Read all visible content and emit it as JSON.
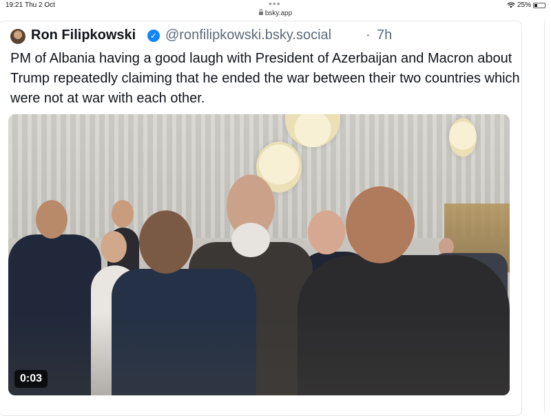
{
  "status_bar": {
    "time": "19:21",
    "date": "Thu 2 Oct",
    "dots": "•••",
    "battery": "25%"
  },
  "browser": {
    "url": "bsky.app"
  },
  "post": {
    "author_name": "Ron Filipkowski",
    "verified_glyph": "✓",
    "handle": "@ronfilipkowski.bsky.social",
    "separator": "·",
    "time": "7h",
    "text": "PM of Albania having a good laugh with President of Azerbaijan and Macron about Trump repeatedly claiming that he ended the war between their two countries which were not at war with each other.",
    "media": {
      "video_time": "0:03"
    }
  },
  "icons": {
    "wifi": "wifi-icon",
    "battery": "battery-icon",
    "lock": "lock-icon",
    "verified": "verified-badge-icon"
  },
  "colors": {
    "verified": "#1185fe",
    "handle": "#5b6b7a",
    "text": "#0f1419"
  }
}
